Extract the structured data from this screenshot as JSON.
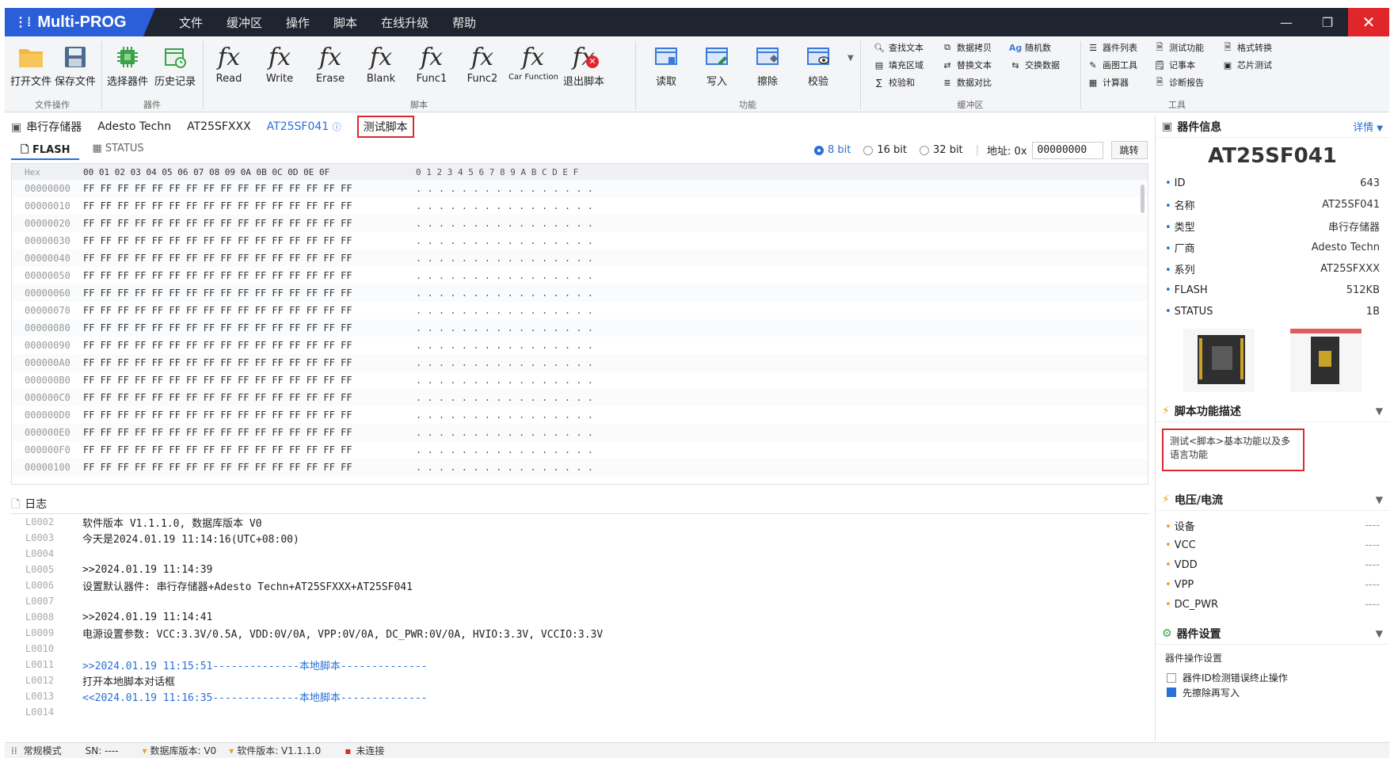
{
  "app": {
    "title": "Multi-PROG",
    "menu": [
      "文件",
      "缓冲区",
      "操作",
      "脚本",
      "在线升级",
      "帮助"
    ]
  },
  "ribbon": {
    "groups": {
      "file_ops": "文件操作",
      "device": "器件",
      "script": "脚本",
      "function": "功能",
      "buffer": "缓冲区",
      "tools": "工具"
    },
    "buttons": {
      "open_file": "打开文件",
      "save_file": "保存文件",
      "select_device": "选择器件",
      "history": "历史记录",
      "read_fx": "Read",
      "write_fx": "Write",
      "erase_fx": "Erase",
      "blank_fx": "Blank",
      "func1": "Func1",
      "func2": "Func2",
      "car_function": "Car Function",
      "exit_script": "退出脚本",
      "read": "读取",
      "write": "写入",
      "erase": "擦除",
      "verify": "校验"
    },
    "buffer_items": [
      "查找文本",
      "填充区域",
      "校验和",
      "数据拷贝",
      "替换文本",
      "数据对比",
      "随机数",
      "交换数据"
    ],
    "tool_items": [
      "器件列表",
      "画图工具",
      "计算器",
      "测试功能",
      "记事本",
      "诊断报告",
      "格式转换",
      "芯片测试"
    ]
  },
  "breadcrumb": [
    "串行存储器",
    "Adesto Techn",
    "AT25SFXXX",
    "AT25SF041",
    "测试脚本"
  ],
  "tabs": [
    "FLASH",
    "STATUS"
  ],
  "bit_options": [
    "8 bit",
    "16 bit",
    "32 bit"
  ],
  "address": {
    "label": "地址: 0x",
    "value": "00000000",
    "jump": "跳转"
  },
  "hex": {
    "header_label": "Hex",
    "header_bytes": "00 01 02 03 04 05 06 07 08 09 0A 0B 0C 0D 0E 0F",
    "header_ascii": "0 1 2 3 4 5 6 7 8 9 A B C D E F",
    "rows": [
      {
        "offset": "00000000",
        "bytes": "FF FF FF FF FF FF FF FF FF FF FF FF FF FF FF FF",
        "ascii": ". . . . . . . . . . . . . . . ."
      },
      {
        "offset": "00000010",
        "bytes": "FF FF FF FF FF FF FF FF FF FF FF FF FF FF FF FF",
        "ascii": ". . . . . . . . . . . . . . . ."
      },
      {
        "offset": "00000020",
        "bytes": "FF FF FF FF FF FF FF FF FF FF FF FF FF FF FF FF",
        "ascii": ". . . . . . . . . . . . . . . ."
      },
      {
        "offset": "00000030",
        "bytes": "FF FF FF FF FF FF FF FF FF FF FF FF FF FF FF FF",
        "ascii": ". . . . . . . . . . . . . . . ."
      },
      {
        "offset": "00000040",
        "bytes": "FF FF FF FF FF FF FF FF FF FF FF FF FF FF FF FF",
        "ascii": ". . . . . . . . . . . . . . . ."
      },
      {
        "offset": "00000050",
        "bytes": "FF FF FF FF FF FF FF FF FF FF FF FF FF FF FF FF",
        "ascii": ". . . . . . . . . . . . . . . ."
      },
      {
        "offset": "00000060",
        "bytes": "FF FF FF FF FF FF FF FF FF FF FF FF FF FF FF FF",
        "ascii": ". . . . . . . . . . . . . . . ."
      },
      {
        "offset": "00000070",
        "bytes": "FF FF FF FF FF FF FF FF FF FF FF FF FF FF FF FF",
        "ascii": ". . . . . . . . . . . . . . . ."
      },
      {
        "offset": "00000080",
        "bytes": "FF FF FF FF FF FF FF FF FF FF FF FF FF FF FF FF",
        "ascii": ". . . . . . . . . . . . . . . ."
      },
      {
        "offset": "00000090",
        "bytes": "FF FF FF FF FF FF FF FF FF FF FF FF FF FF FF FF",
        "ascii": ". . . . . . . . . . . . . . . ."
      },
      {
        "offset": "000000A0",
        "bytes": "FF FF FF FF FF FF FF FF FF FF FF FF FF FF FF FF",
        "ascii": ". . . . . . . . . . . . . . . ."
      },
      {
        "offset": "000000B0",
        "bytes": "FF FF FF FF FF FF FF FF FF FF FF FF FF FF FF FF",
        "ascii": ". . . . . . . . . . . . . . . ."
      },
      {
        "offset": "000000C0",
        "bytes": "FF FF FF FF FF FF FF FF FF FF FF FF FF FF FF FF",
        "ascii": ". . . . . . . . . . . . . . . ."
      },
      {
        "offset": "000000D0",
        "bytes": "FF FF FF FF FF FF FF FF FF FF FF FF FF FF FF FF",
        "ascii": ". . . . . . . . . . . . . . . ."
      },
      {
        "offset": "000000E0",
        "bytes": "FF FF FF FF FF FF FF FF FF FF FF FF FF FF FF FF",
        "ascii": ". . . . . . . . . . . . . . . ."
      },
      {
        "offset": "000000F0",
        "bytes": "FF FF FF FF FF FF FF FF FF FF FF FF FF FF FF FF",
        "ascii": ". . . . . . . . . . . . . . . ."
      },
      {
        "offset": "00000100",
        "bytes": "FF FF FF FF FF FF FF FF FF FF FF FF FF FF FF FF",
        "ascii": ". . . . . . . . . . . . . . . ."
      }
    ]
  },
  "log": {
    "title": "日志",
    "lines": [
      {
        "n": "L0002",
        "t": "软件版本 V1.1.1.0, 数据库版本 V0",
        "blue": false
      },
      {
        "n": "L0003",
        "t": "今天是2024.01.19 11:14:16(UTC+08:00)",
        "blue": false
      },
      {
        "n": "L0004",
        "t": "",
        "blue": false
      },
      {
        "n": "L0005",
        "t": ">>2024.01.19 11:14:39",
        "blue": false
      },
      {
        "n": "L0006",
        "t": "设置默认器件: 串行存储器+Adesto Techn+AT25SFXXX+AT25SF041",
        "blue": false
      },
      {
        "n": "L0007",
        "t": "",
        "blue": false
      },
      {
        "n": "L0008",
        "t": ">>2024.01.19 11:14:41",
        "blue": false
      },
      {
        "n": "L0009",
        "t": "电源设置参数: VCC:3.3V/0.5A, VDD:0V/0A, VPP:0V/0A, DC_PWR:0V/0A, HVIO:3.3V, VCCIO:3.3V",
        "blue": false
      },
      {
        "n": "L0010",
        "t": "",
        "blue": false
      },
      {
        "n": "L0011",
        "t": ">>2024.01.19 11:15:51--------------本地脚本--------------",
        "blue": true
      },
      {
        "n": "L0012",
        "t": "打开本地脚本对话框",
        "blue": false
      },
      {
        "n": "L0013",
        "t": "<<2024.01.19 11:16:35--------------本地脚本--------------",
        "blue": true
      },
      {
        "n": "L0014",
        "t": "",
        "blue": false
      }
    ]
  },
  "device_info": {
    "title": "器件信息",
    "more": "详情",
    "name": "AT25SF041",
    "rows": [
      {
        "k": "ID",
        "v": "643"
      },
      {
        "k": "名称",
        "v": "AT25SF041"
      },
      {
        "k": "类型",
        "v": "串行存储器"
      },
      {
        "k": "厂商",
        "v": "Adesto Techn"
      },
      {
        "k": "系列",
        "v": "AT25SFXXX"
      },
      {
        "k": "FLASH",
        "v": "512KB"
      },
      {
        "k": "STATUS",
        "v": "1B"
      }
    ]
  },
  "script_desc": {
    "title": "脚本功能描述",
    "text": "测试<脚本>基本功能以及多语言功能"
  },
  "power": {
    "title": "电压/电流",
    "rows": [
      {
        "k": "设备",
        "v": "----"
      },
      {
        "k": "VCC",
        "v": "----"
      },
      {
        "k": "VDD",
        "v": "----"
      },
      {
        "k": "VPP",
        "v": "----"
      },
      {
        "k": "DC_PWR",
        "v": "----"
      }
    ]
  },
  "device_settings": {
    "title": "器件设置",
    "subtitle": "器件操作设置",
    "opt1": "器件ID检测错误终止操作",
    "opt2": "先擦除再写入"
  },
  "status": {
    "mode": "常规模式",
    "sn": "SN: ----",
    "db_version": "数据库版本: V0",
    "sw_version": "软件版本: V1.1.1.0",
    "conn": "未连接"
  },
  "colors": {
    "accent": "#2b5fd9",
    "highlight_red": "#d9292e",
    "titlebar": "#1f2530"
  }
}
